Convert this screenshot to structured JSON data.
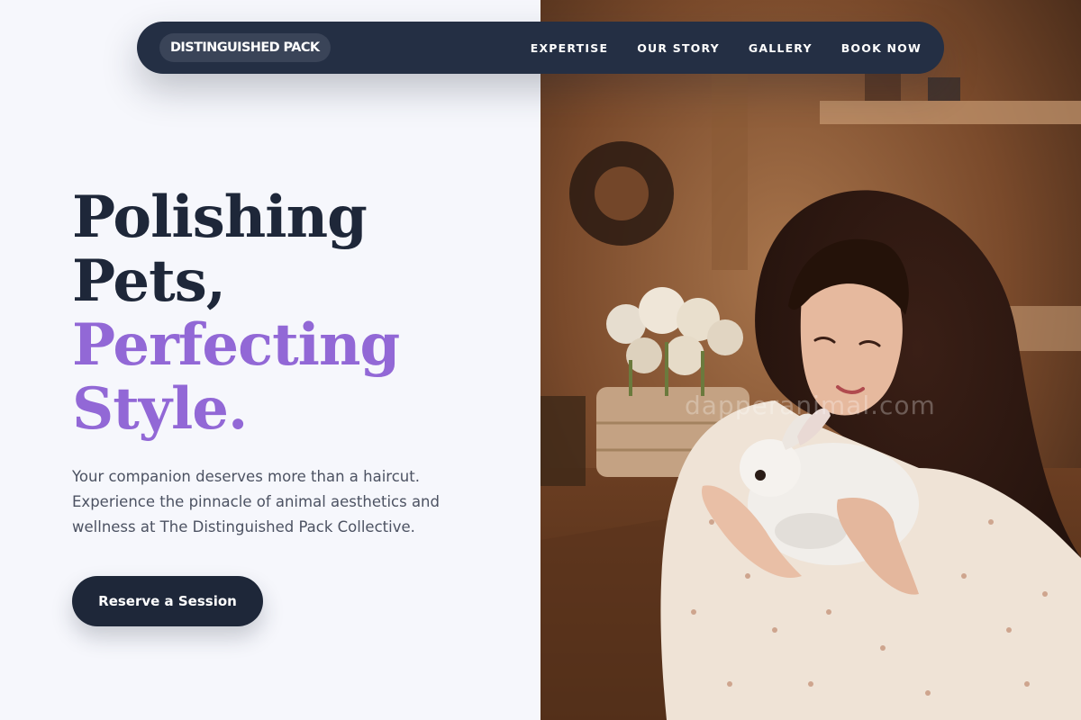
{
  "nav": {
    "logo": "DISTINGUISHED PACK",
    "links": [
      "EXPERTISE",
      "OUR STORY",
      "GALLERY",
      "BOOK NOW"
    ]
  },
  "hero": {
    "headline_line1": "Polishing",
    "headline_line2": "Pets,",
    "headline_accent1": "Perfecting",
    "headline_accent2": "Style.",
    "subtext_line1": "Your companion deserves more than a haircut.",
    "subtext_line2": "Experience the pinnacle of animal aesthetics and",
    "subtext_line3": "wellness at The Distinguished Pack Collective.",
    "cta_label": "Reserve a Session"
  },
  "image": {
    "watermark": "dapperanimal.com"
  },
  "colors": {
    "navy": "#1e2739",
    "accent_purple": "#9268d6",
    "background": "#f6f7fc"
  }
}
